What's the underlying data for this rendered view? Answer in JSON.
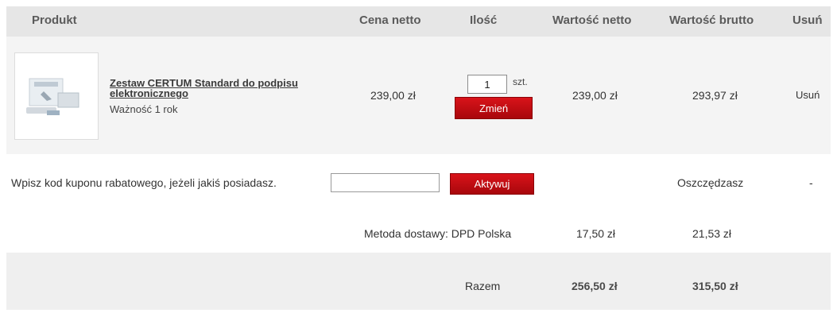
{
  "header": {
    "product": "Produkt",
    "net_price": "Cena netto",
    "quantity": "Ilość",
    "net_value": "Wartość netto",
    "gross_value": "Wartość brutto",
    "remove": "Usuń"
  },
  "item": {
    "name": "Zestaw CERTUM Standard do podpisu elektronicznego",
    "validity": "Ważność 1 rok",
    "net_price": "239,00 zł",
    "quantity_value": "1",
    "quantity_unit": "szt.",
    "change_button": "Zmień",
    "net_value": "239,00 zł",
    "gross_value": "293,97 zł",
    "remove_link": "Usuń"
  },
  "coupon": {
    "prompt": "Wpisz kod kuponu rabatowego, jeżeli jakiś posiadasz.",
    "input_value": "",
    "activate_button": "Aktywuj",
    "savings_label": "Oszczędzasz",
    "savings_value": "-"
  },
  "shipping": {
    "label": "Metoda dostawy: DPD Polska",
    "net": "17,50 zł",
    "gross": "21,53 zł"
  },
  "total": {
    "label": "Razem",
    "net": "256,50 zł",
    "gross": "315,50 zł"
  },
  "colors": {
    "button_red": "#c8101a",
    "header_bg": "#e6e6e6",
    "row_bg": "#f4f4f4"
  },
  "icons": {
    "product_image": "product-kit-image"
  }
}
